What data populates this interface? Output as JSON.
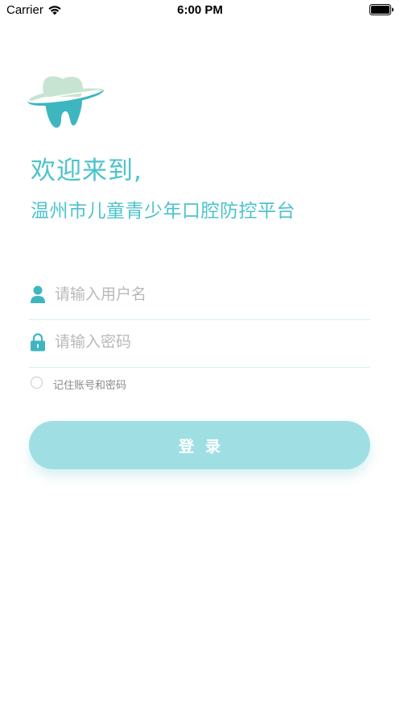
{
  "status_bar": {
    "carrier": "Carrier",
    "time": "6:00 PM",
    "icons": [
      "wifi-icon",
      "battery-icon"
    ]
  },
  "logo": {
    "icon": "tooth-logo-icon",
    "colors": {
      "tooth_light": "#c7e4d2",
      "tooth_dark": "#3eb6c0",
      "ring": "#ffffff"
    }
  },
  "welcome": {
    "line1": "欢迎来到,",
    "line2": "温州市儿童青少年口腔防控平台"
  },
  "form": {
    "username": {
      "icon": "user-icon",
      "value": "",
      "placeholder": "请输入用户名"
    },
    "password": {
      "icon": "lock-icon",
      "value": "",
      "placeholder": "请输入密码"
    },
    "remember": {
      "label": "记住账号和密码",
      "checked": false
    },
    "login_label": "登录"
  },
  "colors": {
    "accent": "#4cc3cc",
    "button": "#9fdfe4",
    "divider": "#d9eef0",
    "placeholder": "#b9b9b9"
  }
}
